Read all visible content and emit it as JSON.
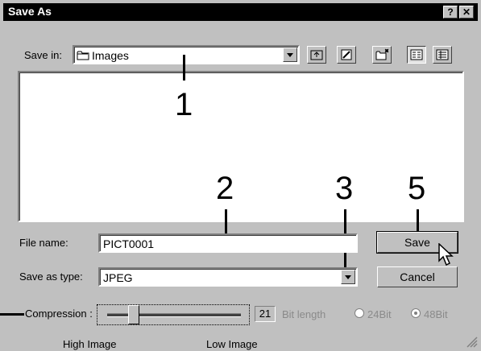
{
  "window": {
    "title": "Save As"
  },
  "title_buttons": {
    "help": "?",
    "close": "✕"
  },
  "save_in": {
    "label": "Save in:",
    "value": "Images"
  },
  "toolbar": {
    "icons": [
      "up-folder-icon",
      "desktop-icon",
      "new-folder-icon",
      "list-view-icon",
      "details-view-icon"
    ]
  },
  "file_name": {
    "label": "File name:",
    "value": "PICT0001"
  },
  "save_as_type": {
    "label": "Save as type:",
    "value": "JPEG"
  },
  "buttons": {
    "save": "Save",
    "cancel": "Cancel"
  },
  "compression": {
    "label": "Compression :",
    "value": "21",
    "left_label": "High Image",
    "right_label": "Low Image",
    "level_fraction": 0.2
  },
  "bit_length": {
    "label": "Bit length",
    "option_24": "24Bit",
    "option_48": "48Bit",
    "selected": "48Bit"
  },
  "callouts": {
    "c1": "1",
    "c2": "2",
    "c3": "3",
    "c5": "5"
  }
}
